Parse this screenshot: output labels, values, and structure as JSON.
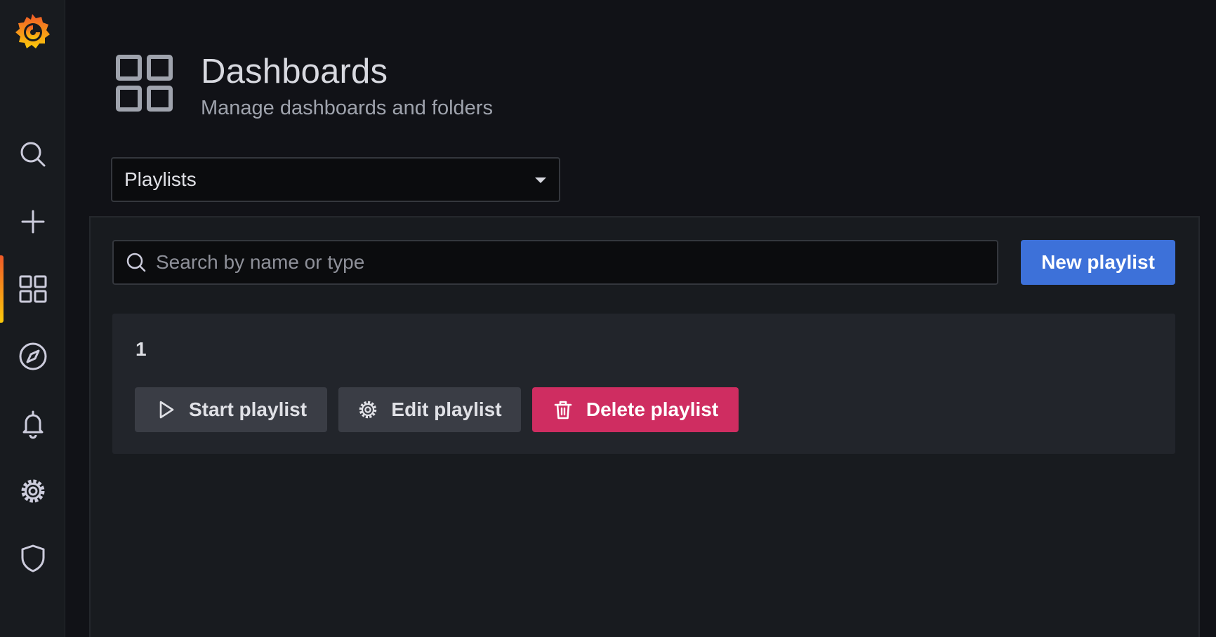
{
  "sidebar": {
    "logo": "grafana-logo",
    "items": [
      {
        "icon": "search-icon",
        "active": false
      },
      {
        "icon": "plus-icon",
        "active": false
      },
      {
        "icon": "dashboards-icon",
        "active": true
      },
      {
        "icon": "compass-icon",
        "active": false
      },
      {
        "icon": "bell-icon",
        "active": false
      },
      {
        "icon": "gear-icon",
        "active": false
      },
      {
        "icon": "shield-icon",
        "active": false
      }
    ]
  },
  "header": {
    "icon": "dashboards-icon",
    "title": "Dashboards",
    "subtitle": "Manage dashboards and folders"
  },
  "tab_select": {
    "selected": "Playlists"
  },
  "search": {
    "placeholder": "Search by name or type",
    "value": ""
  },
  "new_playlist_label": "New playlist",
  "playlists": [
    {
      "name": "1",
      "start_label": "Start playlist",
      "edit_label": "Edit playlist",
      "delete_label": "Delete playlist"
    }
  ],
  "colors": {
    "background": "#111217",
    "panel": "#181b1f",
    "card": "#22252b",
    "primary": "#3d71d9",
    "danger": "#cf2d61",
    "accent_gradient_start": "#f05a28",
    "accent_gradient_end": "#fbca0a"
  }
}
